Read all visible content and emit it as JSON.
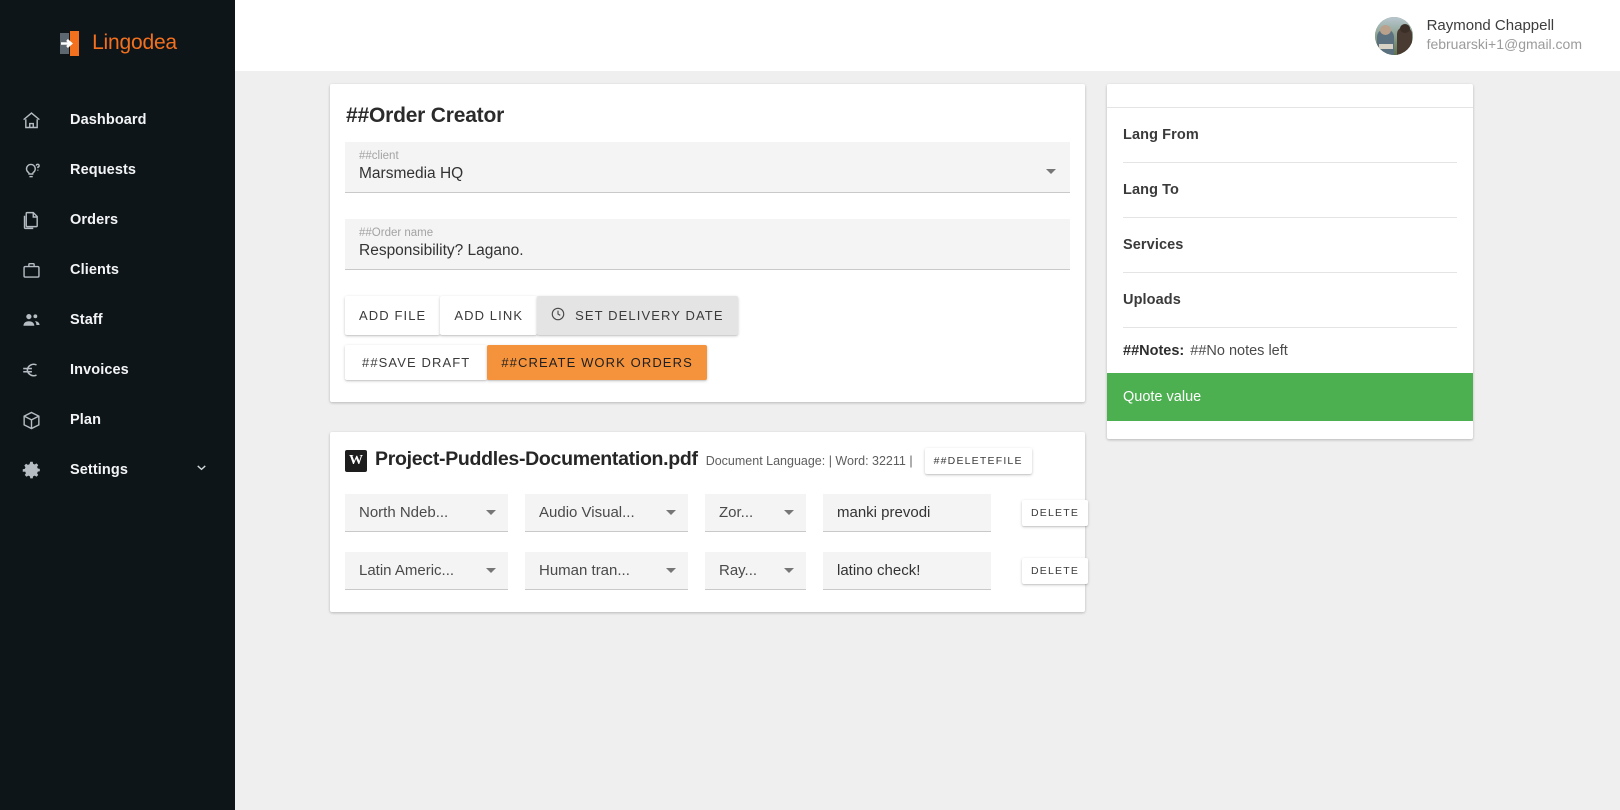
{
  "brand": {
    "name": "Lingodea",
    "accent": "#f2701e"
  },
  "sidebar": {
    "items": [
      {
        "label": "Dashboard",
        "icon": "home-icon"
      },
      {
        "label": "Requests",
        "icon": "lightbulb-question-icon"
      },
      {
        "label": "Orders",
        "icon": "documents-copy-icon"
      },
      {
        "label": "Clients",
        "icon": "briefcase-icon"
      },
      {
        "label": "Staff",
        "icon": "people-icon"
      },
      {
        "label": "Invoices",
        "icon": "euro-icon"
      },
      {
        "label": "Plan",
        "icon": "box-icon"
      },
      {
        "label": "Settings",
        "icon": "gear-icon"
      }
    ]
  },
  "topbar": {
    "user_name": "Raymond Chappell",
    "user_email": "februarski+1@gmail.com"
  },
  "order_creator": {
    "title": "##Order Creator",
    "client": {
      "label": "##client",
      "value": "Marsmedia HQ"
    },
    "order_name": {
      "label": "##Order name",
      "value": "Responsibility? Lagano."
    },
    "buttons": {
      "add_file": "ADD FILE",
      "add_link": "ADD LINK",
      "set_delivery_date": "SET DELIVERY DATE",
      "save_draft": "##SAVE DRAFT",
      "create_work_orders": "##CREATE WORK ORDERS"
    },
    "accent_orange": "#f5933c"
  },
  "file_card": {
    "file_name": "Project-Puddles-Documentation.pdf",
    "badge": "W",
    "meta": "Document Language: | Word: 32211 |",
    "delete_file_label": "##DELETEFILE",
    "rows": [
      {
        "language": "North Ndeb...",
        "service": "Audio Visual...",
        "assignee": "Zor...",
        "note": "manki prevodi",
        "delete_label": "DELETE"
      },
      {
        "language": "Latin Americ...",
        "service": "Human tran...",
        "assignee": "Ray...",
        "note": "latino check!",
        "delete_label": "DELETE"
      }
    ]
  },
  "summary_panel": {
    "items": [
      "Lang From",
      "Lang To",
      "Services",
      "Uploads"
    ],
    "notes_label": "##Notes:",
    "notes_value": "##No notes left",
    "quote_label": "Quote value",
    "quote_color": "#4caf50"
  }
}
